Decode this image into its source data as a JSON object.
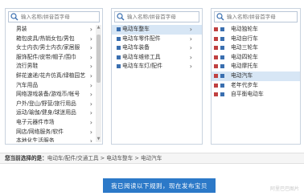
{
  "search_placeholder": "输入名称/拼音首字母",
  "column1": {
    "items": [
      {
        "label": "男装",
        "arrow": "›"
      },
      {
        "label": "箱包皮具/热销女包/男包",
        "arrow": "›"
      },
      {
        "label": "女士内衣/男士内衣/家居服",
        "arrow": "›"
      },
      {
        "label": "服饰配件/皮带/帽子/围巾",
        "arrow": "›"
      },
      {
        "label": "流行男鞋",
        "arrow": "›"
      },
      {
        "label": "鲜花速递/花卉仿真/绿植园艺",
        "arrow": "›"
      },
      {
        "label": "汽车用品",
        "arrow": "›"
      },
      {
        "label": "网络游戏装备/游戏币/帐号",
        "arrow": "›"
      },
      {
        "label": "户外/登山/野营/旅行用品",
        "arrow": "›"
      },
      {
        "label": "运动/瑜伽/健身/球迷用品",
        "arrow": "›"
      },
      {
        "label": "电子元器件市场",
        "arrow": "›"
      },
      {
        "label": "网店/网络服务/软件",
        "arrow": "›"
      },
      {
        "label": "本地化生活服务",
        "arrow": "›"
      }
    ]
  },
  "column2": {
    "items": [
      {
        "label": "电动车整车",
        "arrow": "›",
        "selected": true
      },
      {
        "label": "电动车零件配件",
        "arrow": "›",
        "selected": false
      },
      {
        "label": "电动车装备",
        "arrow": "›",
        "selected": false
      },
      {
        "label": "电动车维修工具",
        "arrow": "›",
        "selected": false
      },
      {
        "label": "电动车车灯/配件",
        "arrow": "›",
        "selected": false
      }
    ]
  },
  "column3": {
    "items": [
      {
        "label": "电动独轮车",
        "selected": false
      },
      {
        "label": "电动自行车",
        "selected": false
      },
      {
        "label": "电动三轮车",
        "selected": false
      },
      {
        "label": "电动四轮车",
        "selected": false
      },
      {
        "label": "电动摩托车",
        "selected": false
      },
      {
        "label": "电动汽车",
        "selected": true
      },
      {
        "label": "老年代步车",
        "selected": false
      },
      {
        "label": "自平衡电动车",
        "selected": false
      }
    ]
  },
  "chosen_prefix": "您当前选择的是：",
  "chosen_path": "电动车/配件/交通工具 > 电动车整车 > 电动汽车",
  "publish_button": "我已阅读以下规则，现在发布宝贝",
  "watermark": "阿里巴巴图片"
}
